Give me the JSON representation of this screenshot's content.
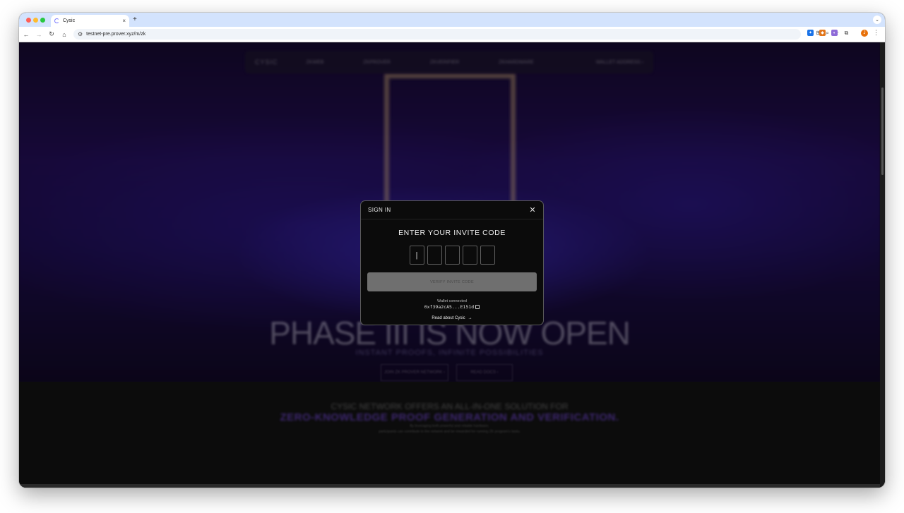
{
  "browser": {
    "tab": {
      "title": "Cysic",
      "close": "×"
    },
    "new_tab": "+",
    "tab_menu": "⌄",
    "nav": {
      "back": "←",
      "forward": "→",
      "reload": "↻",
      "home": "⌂"
    },
    "url": "testnet-pre.prover.xyz/m/zk",
    "site_info_glyph": "⚙",
    "omnibox_icons": {
      "translate": "⊞",
      "zoom": "⌕",
      "bookmark": "☆"
    },
    "extensions": [
      {
        "name": "ext-icon-blue",
        "glyph": "✦",
        "color": "#1a73e8"
      },
      {
        "name": "metamask-icon",
        "glyph": "◆",
        "color": "#e2761b"
      },
      {
        "name": "ext-icon-purple",
        "glyph": "◐",
        "color": "#8e6bd8"
      },
      {
        "name": "puzzle-icon",
        "glyph": "⧉",
        "color": "#ffffff"
      }
    ],
    "profile_initial": "J",
    "menu": "⋮"
  },
  "site": {
    "logo": "CYSIC",
    "nav_links": [
      "ZKWEB",
      "ZKPROVER",
      "ZKVERIFIER",
      "ZKHARDWARE"
    ],
    "nav_right": "WALLET ADDRESS ›",
    "headline": "PHASE III IS NOW OPEN",
    "subheadline": "INSTANT PROOFS, INFINITE POSSIBILITIES",
    "cta_primary": "JOIN ZK PROVER NETWORK ›",
    "cta_secondary": "READ DOCS ›",
    "section_line1": "CYSIC NETWORK OFFERS AN ALL-IN-ONE SOLUTION FOR",
    "section_line2": "ZERO-KNOWLEDGE PROOF GENERATION AND VERIFICATION.",
    "section_line3": "By leveraging both powerful and reliable hardware,",
    "section_line4": "participants can contribute to the network and be rewarded for running ZK program's tasks."
  },
  "modal": {
    "title": "SIGN IN",
    "close": "✕",
    "heading": "ENTER YOUR INVITE CODE",
    "code_inputs": [
      "|",
      "",
      "",
      "",
      ""
    ],
    "verify_label": "VERIFY INVITE CODE",
    "wallet_label": "Wallet connected",
    "wallet_address": "0xf39a2cA5...E151d",
    "read_link": "Read about Cysic",
    "read_arrow": "→"
  }
}
